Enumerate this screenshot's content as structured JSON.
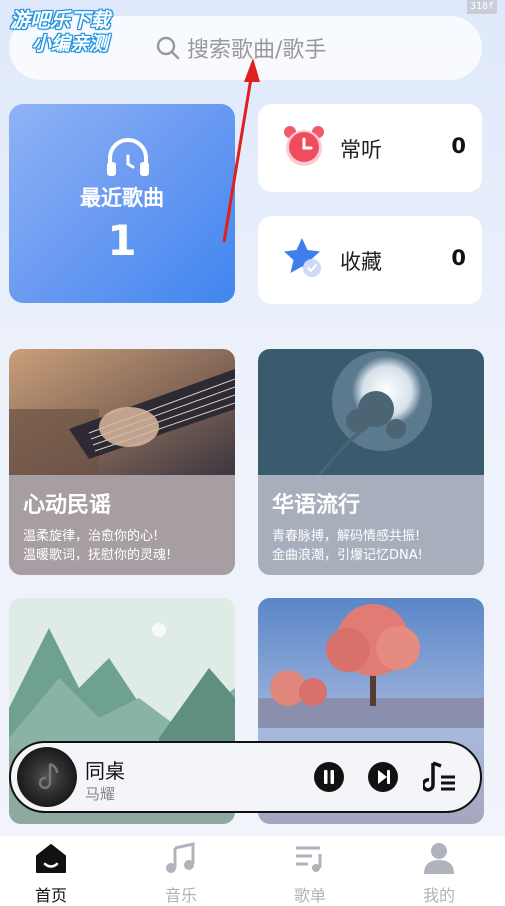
{
  "watermark": {
    "line1": "游吧乐下载",
    "line2": "小编亲测"
  },
  "corner_tag": "318f",
  "search": {
    "placeholder": "搜索歌曲/歌手"
  },
  "recent": {
    "label": "最近歌曲",
    "count": "1"
  },
  "stats": [
    {
      "label": "常听",
      "value": "0",
      "icon": "alarm-clock-icon"
    },
    {
      "label": "收藏",
      "value": "0",
      "icon": "star-icon"
    }
  ],
  "genres": [
    {
      "title": "心动民谣",
      "line1": "温柔旋律，治愈你的心!",
      "line2": "温暖歌词，抚慰你的灵魂!",
      "image": "guitar-photo"
    },
    {
      "title": "华语流行",
      "line1": "青春脉搏，解码情感共振!",
      "line2": "金曲浪潮，引爆记忆DNA!",
      "image": "moon-flower-photo"
    },
    {
      "title": "",
      "line1": "",
      "line2": "",
      "image": "mountain-landscape-photo"
    },
    {
      "title": "",
      "line1": "",
      "line2": "",
      "image": "pink-tree-photo"
    }
  ],
  "player": {
    "song": "同桌",
    "artist": "马耀"
  },
  "nav": [
    {
      "label": "首页",
      "icon": "home-icon",
      "active": true
    },
    {
      "label": "音乐",
      "icon": "music-note-icon",
      "active": false
    },
    {
      "label": "歌单",
      "icon": "playlist-icon",
      "active": false
    },
    {
      "label": "我的",
      "icon": "person-icon",
      "active": false
    }
  ],
  "colors": {
    "accent": "#3f86ef",
    "annotation_arrow": "#e02020"
  }
}
